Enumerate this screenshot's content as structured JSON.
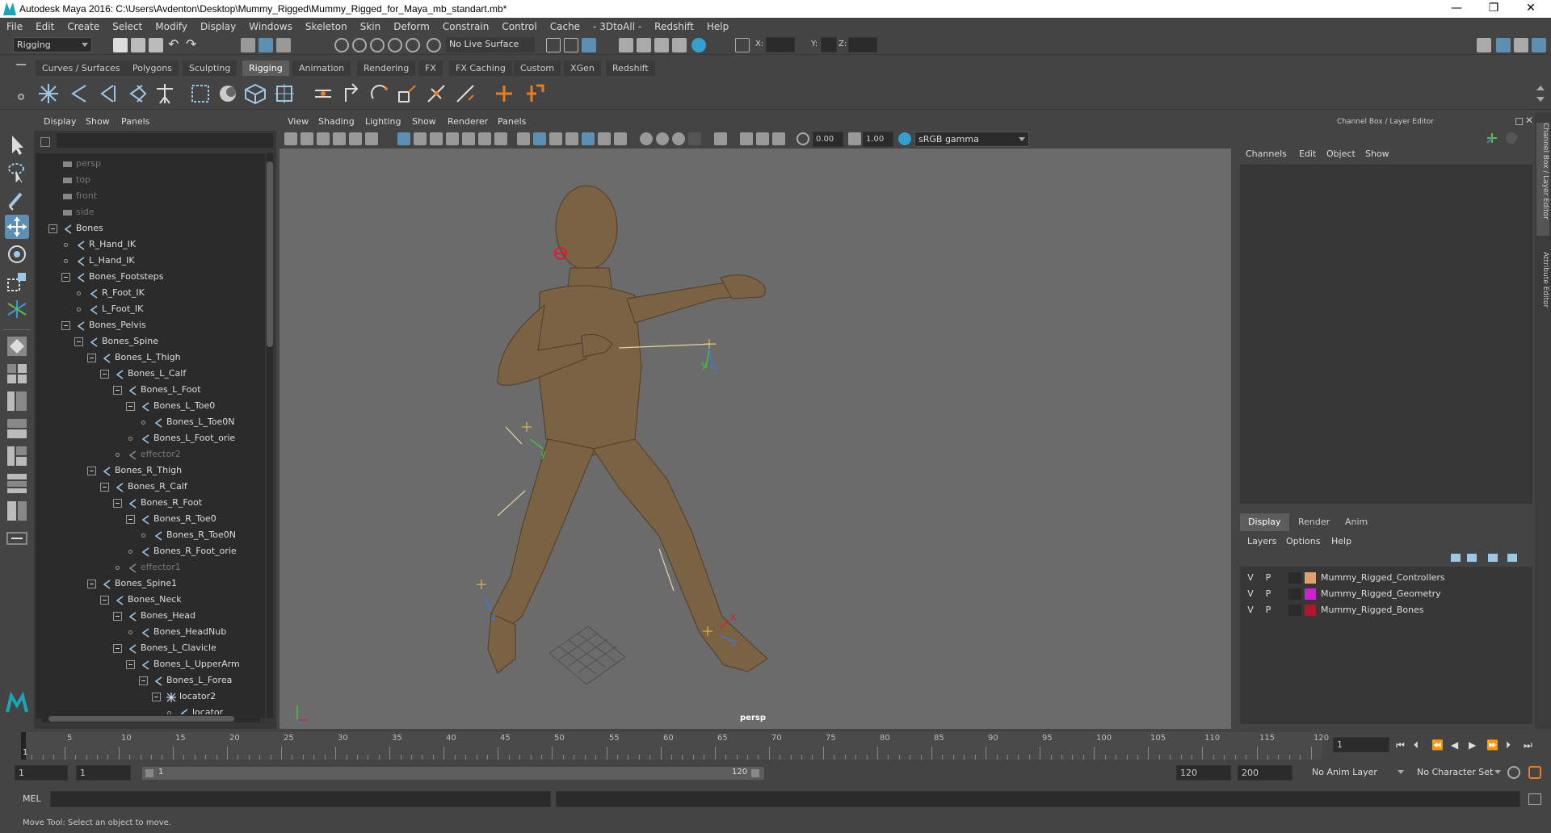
{
  "window": {
    "title": "Autodesk Maya 2016: C:\\Users\\Avdenton\\Desktop\\Mummy_Rigged\\Mummy_Rigged_for_Maya_mb_standart.mb*",
    "minimize": "—",
    "maximize": "❐",
    "close": "✕"
  },
  "menubar": [
    "File",
    "Edit",
    "Create",
    "Select",
    "Modify",
    "Display",
    "Windows",
    "Skeleton",
    "Skin",
    "Deform",
    "Constrain",
    "Control",
    "Cache",
    "- 3DtoAll -",
    "Redshift",
    "Help"
  ],
  "statusline": {
    "menuset": "Rigging",
    "live_surface": "No Live Surface",
    "x_label": "X:",
    "y_label": "Y:",
    "z_label": "Z:"
  },
  "shelf_tabs": [
    "Curves / Surfaces",
    "Polygons",
    "Sculpting",
    "Rigging",
    "Animation",
    "Rendering",
    "FX",
    "FX Caching",
    "Custom",
    "XGen",
    "Redshift"
  ],
  "shelf_active": "Rigging",
  "outliner": {
    "menu": [
      "Display",
      "Show",
      "Panels"
    ],
    "rows": [
      {
        "label": "persp",
        "depth": 0,
        "kind": "camera",
        "dim": true
      },
      {
        "label": "top",
        "depth": 0,
        "kind": "camera",
        "dim": true
      },
      {
        "label": "front",
        "depth": 0,
        "kind": "camera",
        "dim": true
      },
      {
        "label": "side",
        "depth": 0,
        "kind": "camera",
        "dim": true
      },
      {
        "label": "Bones",
        "depth": 0,
        "kind": "joint",
        "exp": true
      },
      {
        "label": "R_Hand_IK",
        "depth": 1,
        "kind": "ik"
      },
      {
        "label": "L_Hand_IK",
        "depth": 1,
        "kind": "ik"
      },
      {
        "label": "Bones_Footsteps",
        "depth": 1,
        "kind": "joint",
        "exp": true
      },
      {
        "label": "R_Foot_IK",
        "depth": 2,
        "kind": "ik"
      },
      {
        "label": "L_Foot_IK",
        "depth": 2,
        "kind": "ik"
      },
      {
        "label": "Bones_Pelvis",
        "depth": 1,
        "kind": "joint",
        "exp": true
      },
      {
        "label": "Bones_Spine",
        "depth": 2,
        "kind": "joint",
        "exp": true
      },
      {
        "label": "Bones_L_Thigh",
        "depth": 3,
        "kind": "joint",
        "exp": true
      },
      {
        "label": "Bones_L_Calf",
        "depth": 4,
        "kind": "joint",
        "exp": true
      },
      {
        "label": "Bones_L_Foot",
        "depth": 5,
        "kind": "joint",
        "exp": true
      },
      {
        "label": "Bones_L_Toe0",
        "depth": 6,
        "kind": "joint",
        "exp": true
      },
      {
        "label": "Bones_L_Toe0N",
        "depth": 7,
        "kind": "joint"
      },
      {
        "label": "Bones_L_Foot_orie",
        "depth": 6,
        "kind": "constraint"
      },
      {
        "label": "effector2",
        "depth": 5,
        "kind": "effector",
        "dim": true
      },
      {
        "label": "Bones_R_Thigh",
        "depth": 3,
        "kind": "joint",
        "exp": true
      },
      {
        "label": "Bones_R_Calf",
        "depth": 4,
        "kind": "joint",
        "exp": true
      },
      {
        "label": "Bones_R_Foot",
        "depth": 5,
        "kind": "joint",
        "exp": true
      },
      {
        "label": "Bones_R_Toe0",
        "depth": 6,
        "kind": "joint",
        "exp": true
      },
      {
        "label": "Bones_R_Toe0N",
        "depth": 7,
        "kind": "joint"
      },
      {
        "label": "Bones_R_Foot_orie",
        "depth": 6,
        "kind": "constraint"
      },
      {
        "label": "effector1",
        "depth": 5,
        "kind": "effector",
        "dim": true
      },
      {
        "label": "Bones_Spine1",
        "depth": 3,
        "kind": "joint",
        "exp": true
      },
      {
        "label": "Bones_Neck",
        "depth": 4,
        "kind": "joint",
        "exp": true
      },
      {
        "label": "Bones_Head",
        "depth": 5,
        "kind": "joint",
        "exp": true
      },
      {
        "label": "Bones_HeadNub",
        "depth": 6,
        "kind": "joint"
      },
      {
        "label": "Bones_L_Clavicle",
        "depth": 5,
        "kind": "joint",
        "exp": true
      },
      {
        "label": "Bones_L_UpperArm",
        "depth": 6,
        "kind": "joint",
        "exp": true
      },
      {
        "label": "Bones_L_Forea",
        "depth": 7,
        "kind": "joint",
        "exp": true
      },
      {
        "label": "locator2",
        "depth": 8,
        "kind": "locator",
        "exp": true
      },
      {
        "label": "locator",
        "depth": 9,
        "kind": "constraint"
      }
    ]
  },
  "viewport": {
    "menu": [
      "View",
      "Shading",
      "Lighting",
      "Show",
      "Renderer",
      "Panels"
    ],
    "field_value_1": "0.00",
    "field_value_2": "1.00",
    "color_space": "sRGB gamma",
    "camera_label": "persp"
  },
  "channelbox": {
    "title": "Channel Box / Layer Editor",
    "menu": [
      "Channels",
      "Edit",
      "Object",
      "Show"
    ],
    "layer_tabs": [
      "Display",
      "Render",
      "Anim"
    ],
    "layer_tab_active": "Display",
    "layer_menu": [
      "Layers",
      "Options",
      "Help"
    ],
    "layers": [
      {
        "v": "V",
        "p": "P",
        "name": "Mummy_Rigged_Controllers",
        "color": "#e0a070"
      },
      {
        "v": "V",
        "p": "P",
        "name": "Mummy_Rigged_Geometry",
        "color": "#cc22cc"
      },
      {
        "v": "V",
        "p": "P",
        "name": "Mummy_Rigged_Bones",
        "color": "#b0162a"
      }
    ],
    "side_tabs": [
      "Channel Box / Layer Editor",
      "Attribute Editor"
    ]
  },
  "timeslider": {
    "ticks": [
      5,
      10,
      15,
      20,
      25,
      30,
      35,
      40,
      45,
      50,
      55,
      60,
      65,
      70,
      75,
      80,
      85,
      90,
      95,
      100,
      105,
      110,
      115,
      120
    ],
    "current_frame_marker": "1",
    "current_frame": "1"
  },
  "rangebar": {
    "start": "1",
    "playback_start": "1",
    "range_start_label": "1",
    "range_end_label": "120",
    "playback_end": "120",
    "end": "200",
    "anim_layer": "No Anim Layer",
    "character_set": "No Character Set"
  },
  "cmdline": {
    "label": "MEL"
  },
  "helpline": {
    "text": "Move Tool: Select an object to move."
  }
}
